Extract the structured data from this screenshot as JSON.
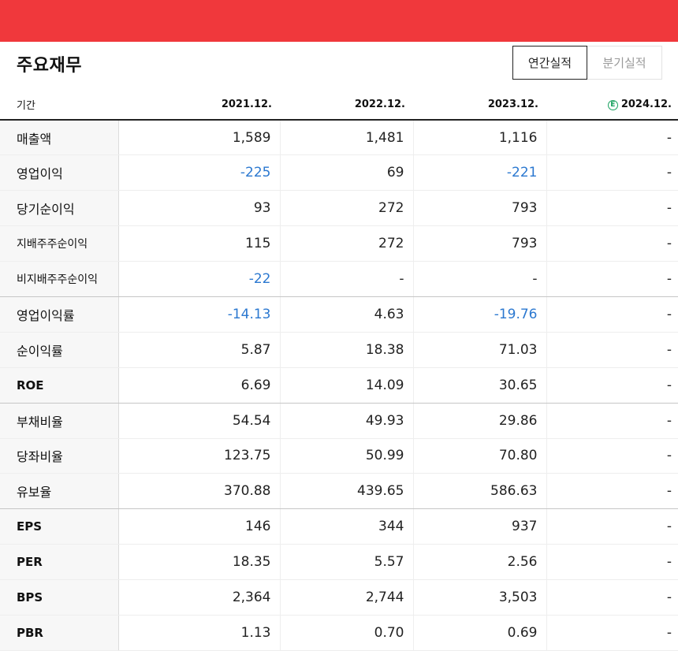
{
  "header": {
    "title": "주요재무",
    "tabs": [
      {
        "label": "연간실적",
        "active": true
      },
      {
        "label": "분기실적",
        "active": false
      }
    ]
  },
  "table": {
    "period_label": "기간",
    "estimate_mark": "E",
    "columns": [
      "2021.12.",
      "2022.12.",
      "2023.12.",
      "2024.12."
    ],
    "rows": [
      {
        "label": "매출액",
        "values": [
          "1,589",
          "1,481",
          "1,116",
          "-"
        ]
      },
      {
        "label": "영업이익",
        "values": [
          "-225",
          "69",
          "-221",
          "-"
        ]
      },
      {
        "label": "당기순이익",
        "values": [
          "93",
          "272",
          "793",
          "-"
        ]
      },
      {
        "label": "지배주주순이익",
        "values": [
          "115",
          "272",
          "793",
          "-"
        ]
      },
      {
        "label": "비지배주주순이익",
        "values": [
          "-22",
          "-",
          "-",
          "-"
        ]
      },
      {
        "label": "영업이익률",
        "values": [
          "-14.13",
          "4.63",
          "-19.76",
          "-"
        ]
      },
      {
        "label": "순이익률",
        "values": [
          "5.87",
          "18.38",
          "71.03",
          "-"
        ]
      },
      {
        "label": "ROE",
        "values": [
          "6.69",
          "14.09",
          "30.65",
          "-"
        ]
      },
      {
        "label": "부채비율",
        "values": [
          "54.54",
          "49.93",
          "29.86",
          "-"
        ]
      },
      {
        "label": "당좌비율",
        "values": [
          "123.75",
          "50.99",
          "70.80",
          "-"
        ]
      },
      {
        "label": "유보율",
        "values": [
          "370.88",
          "439.65",
          "586.63",
          "-"
        ]
      },
      {
        "label": "EPS",
        "values": [
          "146",
          "344",
          "937",
          "-"
        ]
      },
      {
        "label": "PER",
        "values": [
          "18.35",
          "5.57",
          "2.56",
          "-"
        ]
      },
      {
        "label": "BPS",
        "values": [
          "2,364",
          "2,744",
          "3,503",
          "-"
        ]
      },
      {
        "label": "PBR",
        "values": [
          "1.13",
          "0.70",
          "0.69",
          "-"
        ]
      }
    ]
  },
  "colors": {
    "brand_bar": "#f0383c",
    "negative": "#2b78d0",
    "estimate": "#19a15f"
  }
}
